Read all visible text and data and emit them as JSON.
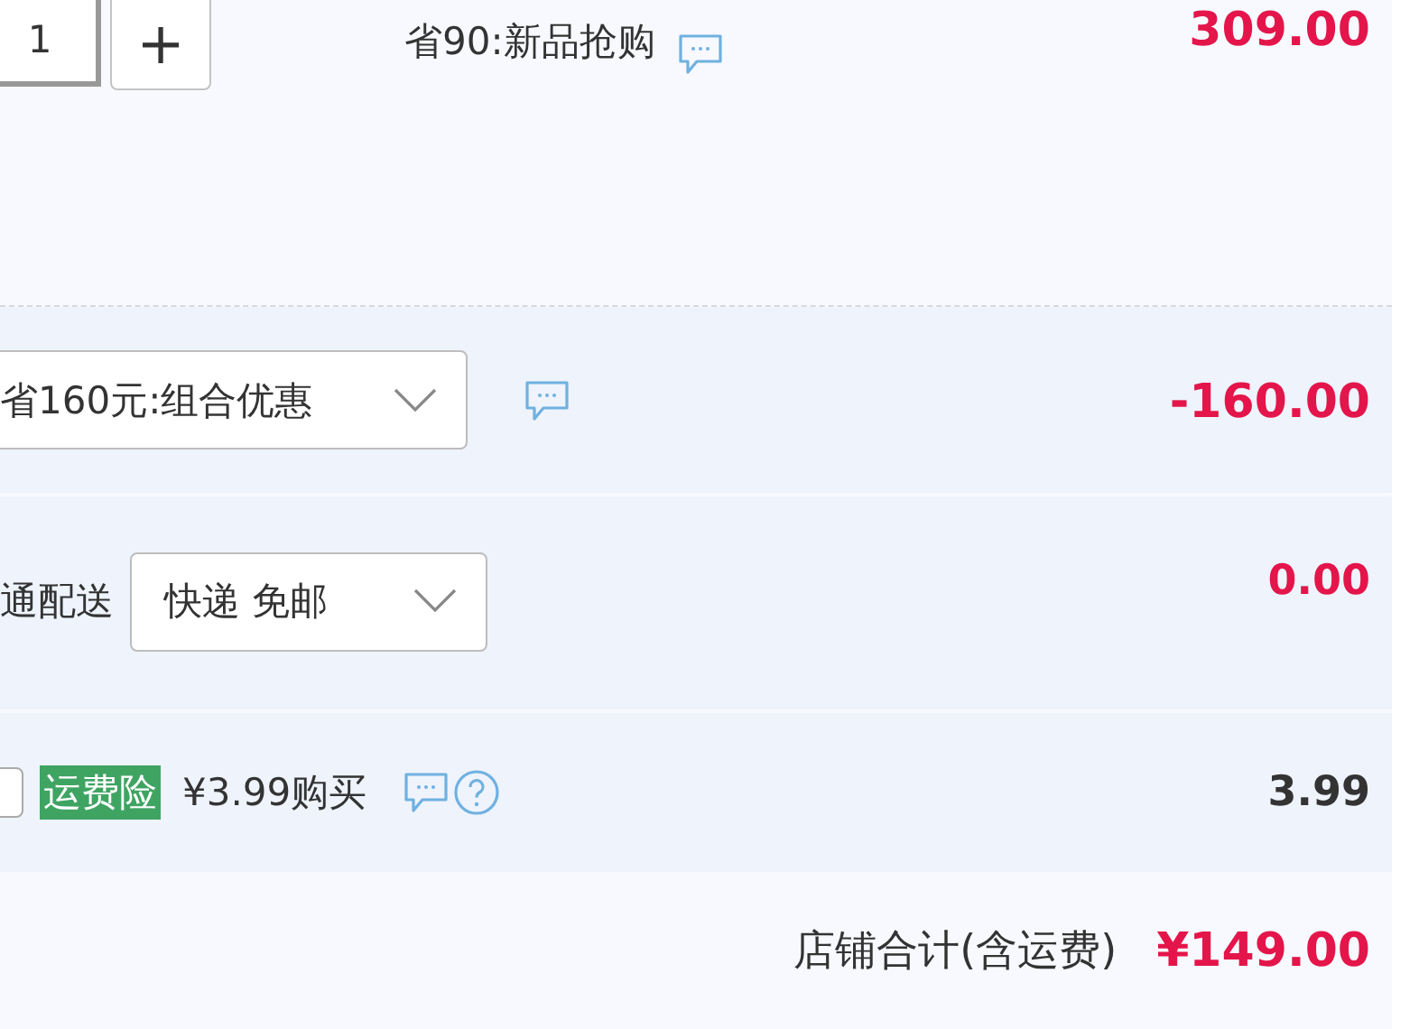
{
  "item": {
    "quantity": "1",
    "increment": "+",
    "promo": "省90:新品抢购",
    "price": "309.00"
  },
  "bundle": {
    "selection": "省160元:组合优惠",
    "amount": "-160.00"
  },
  "shipping": {
    "label": "通配送",
    "selection": "快递 免邮",
    "amount": "0.00"
  },
  "insurance": {
    "checked": false,
    "badge": "运费险",
    "offer": "¥3.99购买",
    "amount": "3.99"
  },
  "total": {
    "label": "店铺合计(含运费)",
    "amount": "¥149.00"
  }
}
